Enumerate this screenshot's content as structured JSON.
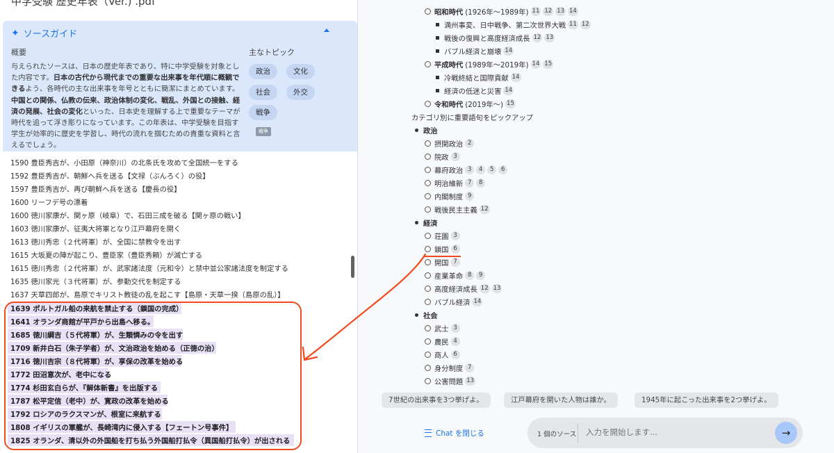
{
  "left": {
    "doc_title": "中学受験 歴史年表（Ver.) .pdf",
    "guide": {
      "title": "ソースガイド",
      "summary_label": "概要",
      "topics_label": "主なトピック",
      "summary_parts": [
        {
          "t": "与えられたソースは、日本の歴史年表であり、特に中学受験を対象とした内容です。",
          "b": false
        },
        {
          "t": "日本の古代から現代までの重要な出来事を年代順に概観できる",
          "b": true
        },
        {
          "t": "よう、各時代の主な出来事を年号とともに簡潔にまとめています。",
          "b": false
        },
        {
          "t": "中国との関係、仏教の伝来、政治体制の変化、戦乱、外国との接触、経済の発展、社会の変化",
          "b": true
        },
        {
          "t": "といった、日本史を理解する上で重要なテーマが時代を追って浮き彫りになっています。この年表は、中学受験を目指す学生が効率的に歴史を学習し、時代の流れを掴むための貴重な資料と言えるでしょう。",
          "b": false
        }
      ],
      "topics": [
        "政治",
        "文化",
        "社会",
        "外交",
        "戦争"
      ],
      "small_chip": "戦争"
    },
    "timeline": [
      "1590 豊臣秀吉が、小田原（神奈川）の北条氏を攻めて全国統一をする",
      "1592 豊臣秀吉が、朝鮮へ兵を送る【文禄（ぶんろく）の役】",
      "1597 豊臣秀吉が、再び朝鮮へ兵を送る【慶長の役】",
      "1600 リーフデ号の漂着",
      "1600 徳川家康が、関ヶ原（岐阜）で、石田三成を破る【関ヶ原の戦い】",
      "1603 徳川家康が、征夷大将軍となり江戸幕府を開く",
      "1613 徳川秀忠（２代将軍）が、全国に禁教令を出す",
      "1615 大坂夏の陣が起こり、豊臣家（豊臣秀頼）が滅亡する",
      "1615 徳川秀忠（２代将軍）が、武家諸法度（元和令）と禁中並公家諸法度を制定する",
      "1635 徳川家光（３代将軍）が、参勤交代を制定する",
      "1637 天草四郎が、島原でキリスト教徒の乱を起こす【島原・天草一揆（島原の乱）】"
    ],
    "highlighted": [
      "1639 ポルトガル船の来航を禁止する（鎖国の完成）",
      "1641 オランダ商館が平戸から出島へ移る。",
      "1685 徳川綱吉（５代将軍）が、生類憐みの令を出す",
      "1709 新井白石（朱子学者）が、文治政治を始める（正徳の治）",
      "1716 徳川吉宗（８代将軍）が、享保の改革を始める",
      "1772 田沼意次が、老中になる",
      "1774 杉田玄白らが、『解体新書』を出版する",
      "1787 松平定信（老中）が、寛政の改革を始める",
      "1792 ロシアのラクスマンが、根室に来航する",
      "1808 イギリスの軍艦が、長崎湾内に侵入する【フェートン号事件】",
      "1825 オランダ、清以外の外国船を打ち払う外国船打払令（異国船打払令）が出される"
    ]
  },
  "right": {
    "outline": [
      {
        "kind": "circ",
        "bold": true,
        "label": "昭和時代",
        "extra": "(1926年〜1989年)",
        "cites": [
          "11",
          "12",
          "13",
          "14"
        ]
      },
      {
        "kind": "sq",
        "label": "満州事変、日中戦争、第二次世界大戦",
        "cites": [
          "11",
          "12"
        ]
      },
      {
        "kind": "sq",
        "label": "戦後の復興と高度経済成長",
        "cites": [
          "12",
          "13"
        ]
      },
      {
        "kind": "sq",
        "label": "バブル経済と崩壊",
        "cites": [
          "14"
        ]
      },
      {
        "kind": "circ",
        "bold": true,
        "label": "平成時代",
        "extra": "(1989年〜2019年)",
        "cites": [
          "14",
          "15"
        ]
      },
      {
        "kind": "sq",
        "label": "冷戦終結と国際貢献",
        "cites": [
          "14"
        ]
      },
      {
        "kind": "sq",
        "label": "経済の低迷と災害",
        "cites": [
          "14"
        ]
      },
      {
        "kind": "circ",
        "bold": true,
        "label": "令和時代",
        "extra": "(2019年〜)",
        "cites": [
          "15"
        ]
      },
      {
        "kind": "heading",
        "label": "カテゴリ別に重要語句をピックアップ",
        "cites": []
      },
      {
        "kind": "dot",
        "bold": true,
        "label": "政治",
        "cites": []
      },
      {
        "kind": "circ",
        "label": "摂関政治",
        "cites": [
          "2"
        ]
      },
      {
        "kind": "circ",
        "label": "院政",
        "cites": [
          "3"
        ]
      },
      {
        "kind": "circ",
        "label": "幕府政治",
        "cites": [
          "3",
          "4",
          "5",
          "6"
        ]
      },
      {
        "kind": "circ",
        "label": "明治維新",
        "cites": [
          "7",
          "8"
        ]
      },
      {
        "kind": "circ",
        "label": "内閣制度",
        "cites": [
          "9"
        ]
      },
      {
        "kind": "circ",
        "label": "戦後民主主義",
        "cites": [
          "12"
        ]
      },
      {
        "kind": "dot",
        "bold": true,
        "label": "経済",
        "cites": []
      },
      {
        "kind": "circ",
        "label": "荘園",
        "cites": [
          "3"
        ]
      },
      {
        "kind": "circ",
        "label": "鎖国",
        "cites": [
          "6"
        ]
      },
      {
        "kind": "circ",
        "label": "開国",
        "cites": [
          "7"
        ]
      },
      {
        "kind": "circ",
        "label": "産業革命",
        "cites": [
          "8",
          "9"
        ]
      },
      {
        "kind": "circ",
        "label": "高度経済成長",
        "cites": [
          "12",
          "13"
        ]
      },
      {
        "kind": "circ",
        "label": "バブル経済",
        "cites": [
          "14"
        ]
      },
      {
        "kind": "dot",
        "bold": true,
        "label": "社会",
        "cites": []
      },
      {
        "kind": "circ",
        "label": "武士",
        "cites": [
          "3"
        ]
      },
      {
        "kind": "circ",
        "label": "農民",
        "cites": [
          "4"
        ]
      },
      {
        "kind": "circ",
        "label": "商人",
        "cites": [
          "6"
        ]
      },
      {
        "kind": "circ",
        "label": "身分制度",
        "cites": [
          "7"
        ]
      },
      {
        "kind": "circ",
        "label": "公害問題",
        "cites": [
          "13"
        ]
      }
    ],
    "suggestions": [
      "7世紀の出来事を3つ挙げよ。",
      "江戸幕府を開いた人物は誰か。",
      "1945年に起こった出来事を2つ挙げよ。"
    ],
    "close_chat": "Chat を閉じる",
    "source_count": "1 個のソース",
    "input_placeholder": "入力を開始します...",
    "accent": "#1a73e8",
    "annotation_color": "#f04a1d"
  }
}
